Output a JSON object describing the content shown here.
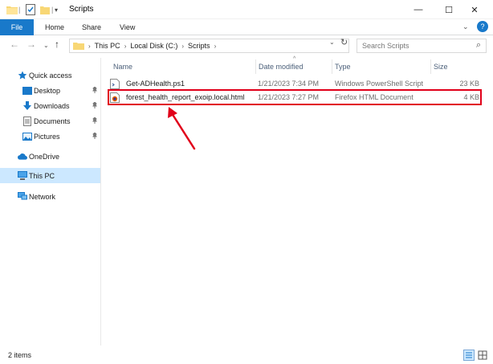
{
  "window": {
    "title": "Scripts",
    "minimize_glyph": "—",
    "maximize_glyph": "☐",
    "close_glyph": "✕"
  },
  "ribbon": {
    "tabs": [
      "File",
      "Home",
      "Share",
      "View"
    ],
    "expand_glyph": "⌄",
    "help_glyph": "?"
  },
  "nav": {
    "back_glyph": "←",
    "forward_glyph": "→",
    "recent_glyph": "⌄",
    "up_glyph": "↑",
    "breadcrumb": [
      "This PC",
      "Local Disk (C:)",
      "Scripts"
    ],
    "breadcrumb_sep": "›",
    "dropdown_glyph": "⌄",
    "refresh_glyph": "↻",
    "search_placeholder": "Search Scripts",
    "search_glyph": "⌕"
  },
  "sidebar": {
    "items": [
      {
        "label": "Quick access",
        "icon": "star-icon",
        "pinned": false
      },
      {
        "label": "Desktop",
        "icon": "desktop-icon",
        "pinned": true
      },
      {
        "label": "Downloads",
        "icon": "download-icon",
        "pinned": true
      },
      {
        "label": "Documents",
        "icon": "documents-icon",
        "pinned": true
      },
      {
        "label": "Pictures",
        "icon": "pictures-icon",
        "pinned": true
      },
      {
        "label": "OneDrive",
        "icon": "cloud-icon",
        "pinned": false
      },
      {
        "label": "This PC",
        "icon": "computer-icon",
        "pinned": false,
        "selected": true
      },
      {
        "label": "Network",
        "icon": "network-icon",
        "pinned": false
      }
    ],
    "pin_glyph": "📌"
  },
  "files": {
    "columns": [
      "Name",
      "Date modified",
      "Type",
      "Size"
    ],
    "sort_glyph": "^",
    "rows": [
      {
        "name": "Get-ADHealth.ps1",
        "date": "1/21/2023 7:34 PM",
        "type": "Windows PowerShell Script",
        "size": "23 KB",
        "icon": "powershell-file-icon"
      },
      {
        "name": "forest_health_report_exoip.local.html",
        "date": "1/21/2023 7:27 PM",
        "type": "Firefox HTML Document",
        "size": "4 KB",
        "icon": "firefox-file-icon",
        "highlighted": true
      }
    ]
  },
  "status": {
    "item_count": "2 items"
  },
  "colors": {
    "accent": "#1979ca",
    "selection": "#cce8ff",
    "highlight_border": "#e1001a",
    "annotation_arrow": "#e1001a"
  }
}
